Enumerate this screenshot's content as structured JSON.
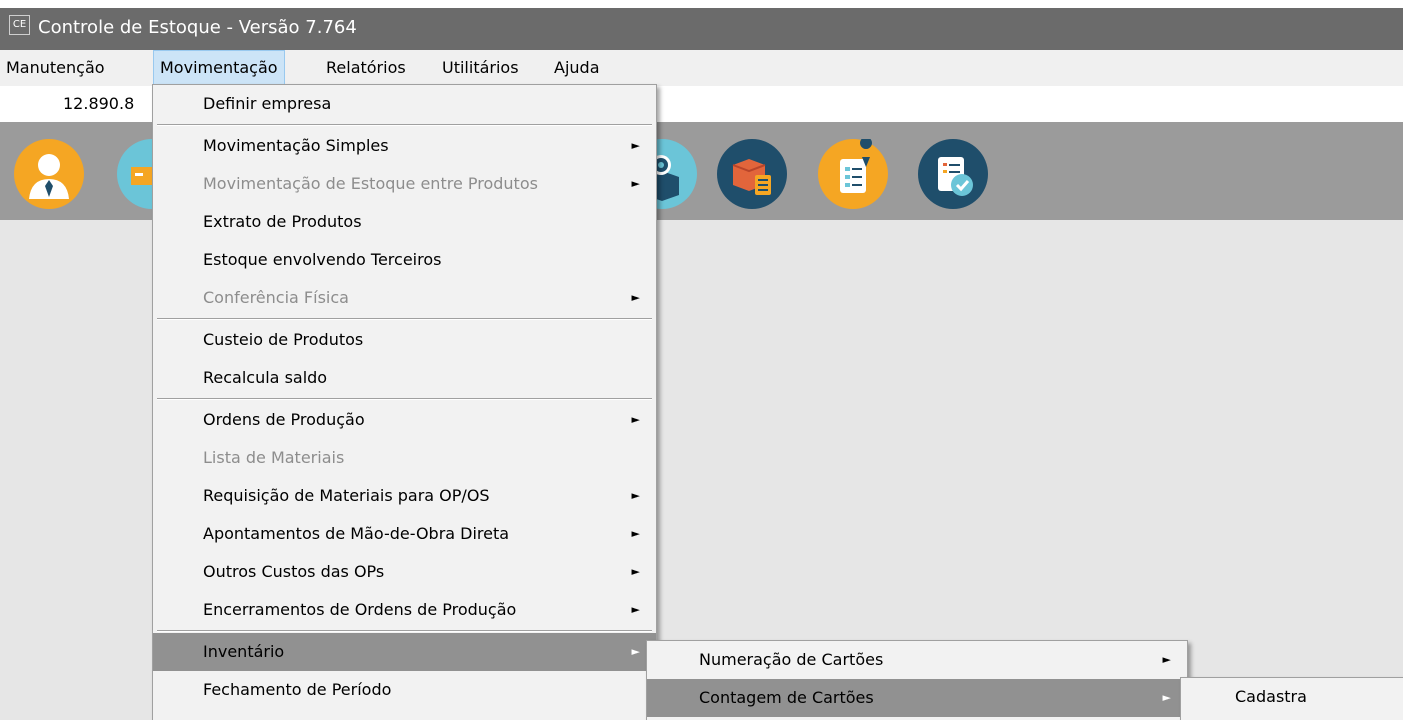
{
  "window": {
    "app_icon": "CE",
    "title": "Controle de Estoque - Versão 7.764"
  },
  "menubar": [
    {
      "label": "Manutenção"
    },
    {
      "label": "Movimentação"
    },
    {
      "label": "Relatórios"
    },
    {
      "label": "Utilitários"
    },
    {
      "label": "Ajuda"
    }
  ],
  "value_bar": {
    "value": "12.890.8"
  },
  "toolbar": {
    "icons": [
      {
        "name": "user-icon"
      },
      {
        "name": "truck-icon"
      },
      {
        "name": "box-money-icon"
      },
      {
        "name": "box-checklist-icon"
      },
      {
        "name": "clipboard-location-icon"
      },
      {
        "name": "document-check-icon"
      }
    ]
  },
  "movimentacao_menu": {
    "items": [
      {
        "label": "Definir empresa"
      },
      {
        "label": "Movimentação Simples"
      },
      {
        "label": "Movimentação de Estoque entre Produtos"
      },
      {
        "label": "Extrato de Produtos"
      },
      {
        "label": "Estoque envolvendo Terceiros"
      },
      {
        "label": "Conferência Física"
      },
      {
        "label": "Custeio de Produtos"
      },
      {
        "label": "Recalcula saldo"
      },
      {
        "label": "Ordens de Produção"
      },
      {
        "label": "Lista de Materiais"
      },
      {
        "label": "Requisição de Materiais para OP/OS"
      },
      {
        "label": "Apontamentos de Mão-de-Obra Direta"
      },
      {
        "label": "Outros Custos das OPs"
      },
      {
        "label": "Encerramentos de Ordens de Produção"
      },
      {
        "label": "Inventário"
      },
      {
        "label": "Fechamento de Período"
      }
    ],
    "submenu_arrow": "►"
  },
  "inventario_menu": {
    "items": [
      {
        "label": "Numeração de  Cartões"
      },
      {
        "label": "Contagem de Cartões"
      }
    ]
  },
  "contagem_menu": {
    "items": [
      {
        "label": "Cadastra"
      }
    ]
  },
  "colors": {
    "titlebar": "#6b6b6b",
    "menubar": "#f0f0f0",
    "toolbar": "#9b9b9b",
    "workspace": "#e6e6e6",
    "highlight": "#919191",
    "icon_orange": "#f5a623",
    "icon_navy": "#1f4e6b",
    "icon_teal": "#6bc5d8"
  }
}
